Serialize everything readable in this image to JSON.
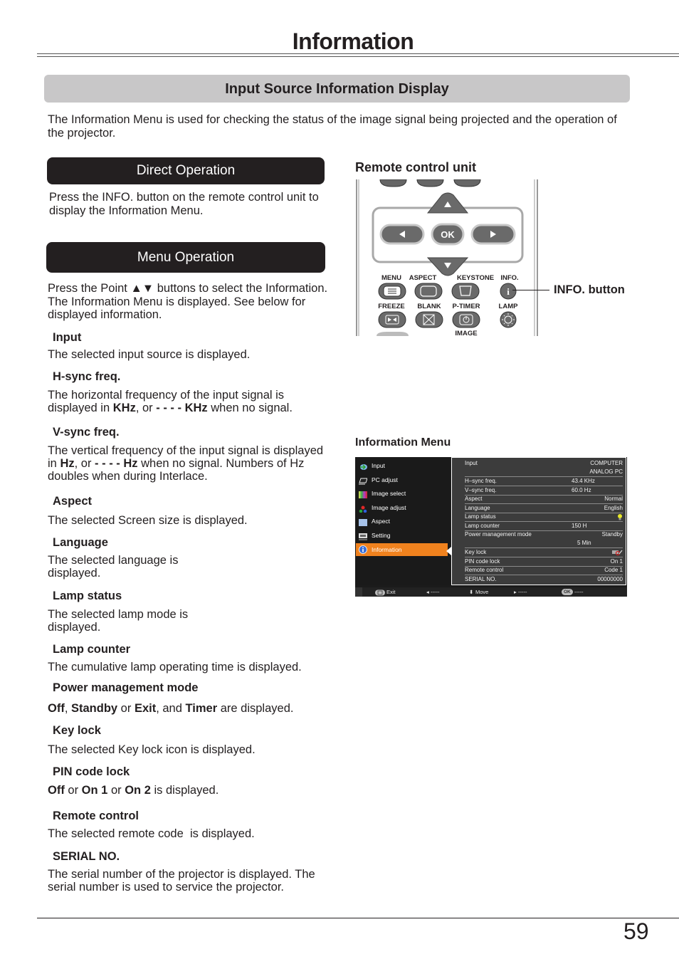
{
  "header": {
    "title": "Information",
    "section_title": "Input Source Information Display",
    "intro": "The Information Menu is used for checking the status of the image signal being projected and the operation of the projector."
  },
  "direct_operation": {
    "label": "Direct Operation",
    "text": "Press the INFO. button on the remote control unit to display the Information Menu."
  },
  "menu_operation": {
    "label": "Menu Operation",
    "text": "Press the Point ▲▼ buttons to select the Information. The Information Menu is displayed. See below for displayed information."
  },
  "items": [
    {
      "title": "Input",
      "desc": "The selected input source is displayed."
    },
    {
      "title": "H-sync freq.",
      "desc_parts": [
        "The horizontal frequency of the input signal is displayed in ",
        "KHz",
        ", or ",
        "- - - - KHz",
        " when no signal."
      ]
    },
    {
      "title": "V-sync freq.",
      "desc_parts": [
        "The vertical frequency of the input signal is displayed in ",
        "Hz",
        ", or ",
        "- - - - Hz",
        " when no signal. Numbers of Hz doubles when during Interlace."
      ]
    },
    {
      "title": "Aspect",
      "desc": "The selected Screen size is displayed."
    },
    {
      "title": "Language",
      "desc": "The selected language is displayed."
    },
    {
      "title": "Lamp status",
      "desc": "The selected lamp mode is displayed."
    },
    {
      "title": "Lamp counter",
      "desc": "The cumulative lamp operating time is displayed."
    },
    {
      "title": "Power management mode",
      "desc_parts": [
        "Off",
        ", ",
        "Standby",
        " or ",
        "Exit",
        ", and ",
        "Timer",
        " are displayed."
      ]
    },
    {
      "title": "Key lock",
      "desc": "The selected Key lock icon is displayed."
    },
    {
      "title": "PIN code lock",
      "desc_parts": [
        "Off",
        " or ",
        "On 1",
        " or ",
        "On 2",
        " is displayed."
      ]
    },
    {
      "title": "Remote control",
      "desc": "The selected remote code  is displayed."
    },
    {
      "title": "SERIAL NO.",
      "desc": "The serial number of the projector is displayed. The serial number is used to service the projector."
    }
  ],
  "remote": {
    "caption": "Remote control unit",
    "ok_label": "OK",
    "button_labels": {
      "menu": "MENU",
      "aspect": "ASPECT",
      "keystone": "KEYSTONE",
      "info": "INFO.",
      "freeze": "FREEZE",
      "blank": "BLANK",
      "ptimer": "P-TIMER",
      "lamp": "LAMP",
      "image": "IMAGE"
    },
    "callout": "INFO. button"
  },
  "osd": {
    "caption": "Information Menu",
    "menu": [
      {
        "label": "Input",
        "icon": "input-icon"
      },
      {
        "label": "PC adjust",
        "icon": "pc-adjust-icon"
      },
      {
        "label": "Image select",
        "icon": "image-select-icon"
      },
      {
        "label": "Image adjust",
        "icon": "image-adjust-icon"
      },
      {
        "label": "Aspect",
        "icon": "aspect-icon"
      },
      {
        "label": "Setting",
        "icon": "setting-icon"
      },
      {
        "label": "Information",
        "icon": "information-icon",
        "active": true
      }
    ],
    "rows": [
      {
        "key": "Input",
        "value": "COMPUTER"
      },
      {
        "key": "",
        "value": "ANALOG PC"
      },
      {
        "key": "H–sync freq.",
        "value": "43.4  KHz"
      },
      {
        "key": "V–sync freq.",
        "value": "60.0  Hz"
      },
      {
        "key": "Aspect",
        "value": "Normal"
      },
      {
        "key": "Language",
        "value": "English"
      },
      {
        "key": "Lamp status",
        "value": ""
      },
      {
        "key": "Lamp counter",
        "value": "150  H"
      },
      {
        "key": "Power management mode",
        "value": "Standby"
      },
      {
        "key": "",
        "value": "5  Min"
      },
      {
        "key": "Key lock",
        "value": ""
      },
      {
        "key": "PIN code lock",
        "value": "On 1"
      },
      {
        "key": "Remote control",
        "value": "Code 1"
      },
      {
        "key": "SERIAL NO.",
        "value": "00000000"
      }
    ],
    "bottom": {
      "exit": "Exit",
      "left": "-----",
      "move": "Move",
      "right": "-----",
      "ok_badge": "OK",
      "ok": "-----"
    },
    "colors": {
      "active": "#f0821e",
      "panel": "#3c3c3c",
      "background": "#1b1b1b"
    }
  },
  "footer": {
    "page_number": "59"
  }
}
